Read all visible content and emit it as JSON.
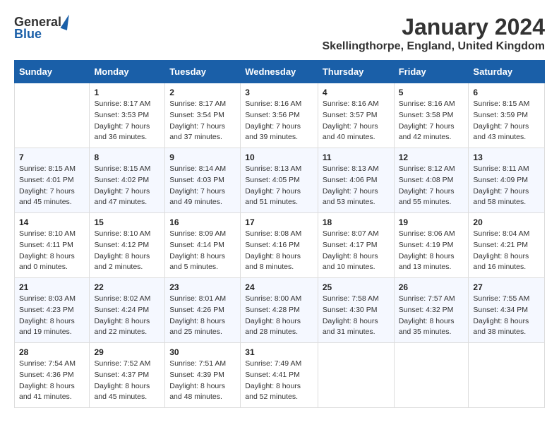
{
  "header": {
    "logo_general": "General",
    "logo_blue": "Blue",
    "month_title": "January 2024",
    "location": "Skellingthorpe, England, United Kingdom"
  },
  "days_of_week": [
    "Sunday",
    "Monday",
    "Tuesday",
    "Wednesday",
    "Thursday",
    "Friday",
    "Saturday"
  ],
  "weeks": [
    [
      {
        "day": "",
        "sunrise": "",
        "sunset": "",
        "daylight": ""
      },
      {
        "day": "1",
        "sunrise": "Sunrise: 8:17 AM",
        "sunset": "Sunset: 3:53 PM",
        "daylight": "Daylight: 7 hours and 36 minutes."
      },
      {
        "day": "2",
        "sunrise": "Sunrise: 8:17 AM",
        "sunset": "Sunset: 3:54 PM",
        "daylight": "Daylight: 7 hours and 37 minutes."
      },
      {
        "day": "3",
        "sunrise": "Sunrise: 8:16 AM",
        "sunset": "Sunset: 3:56 PM",
        "daylight": "Daylight: 7 hours and 39 minutes."
      },
      {
        "day": "4",
        "sunrise": "Sunrise: 8:16 AM",
        "sunset": "Sunset: 3:57 PM",
        "daylight": "Daylight: 7 hours and 40 minutes."
      },
      {
        "day": "5",
        "sunrise": "Sunrise: 8:16 AM",
        "sunset": "Sunset: 3:58 PM",
        "daylight": "Daylight: 7 hours and 42 minutes."
      },
      {
        "day": "6",
        "sunrise": "Sunrise: 8:15 AM",
        "sunset": "Sunset: 3:59 PM",
        "daylight": "Daylight: 7 hours and 43 minutes."
      }
    ],
    [
      {
        "day": "7",
        "sunrise": "Sunrise: 8:15 AM",
        "sunset": "Sunset: 4:01 PM",
        "daylight": "Daylight: 7 hours and 45 minutes."
      },
      {
        "day": "8",
        "sunrise": "Sunrise: 8:15 AM",
        "sunset": "Sunset: 4:02 PM",
        "daylight": "Daylight: 7 hours and 47 minutes."
      },
      {
        "day": "9",
        "sunrise": "Sunrise: 8:14 AM",
        "sunset": "Sunset: 4:03 PM",
        "daylight": "Daylight: 7 hours and 49 minutes."
      },
      {
        "day": "10",
        "sunrise": "Sunrise: 8:13 AM",
        "sunset": "Sunset: 4:05 PM",
        "daylight": "Daylight: 7 hours and 51 minutes."
      },
      {
        "day": "11",
        "sunrise": "Sunrise: 8:13 AM",
        "sunset": "Sunset: 4:06 PM",
        "daylight": "Daylight: 7 hours and 53 minutes."
      },
      {
        "day": "12",
        "sunrise": "Sunrise: 8:12 AM",
        "sunset": "Sunset: 4:08 PM",
        "daylight": "Daylight: 7 hours and 55 minutes."
      },
      {
        "day": "13",
        "sunrise": "Sunrise: 8:11 AM",
        "sunset": "Sunset: 4:09 PM",
        "daylight": "Daylight: 7 hours and 58 minutes."
      }
    ],
    [
      {
        "day": "14",
        "sunrise": "Sunrise: 8:10 AM",
        "sunset": "Sunset: 4:11 PM",
        "daylight": "Daylight: 8 hours and 0 minutes."
      },
      {
        "day": "15",
        "sunrise": "Sunrise: 8:10 AM",
        "sunset": "Sunset: 4:12 PM",
        "daylight": "Daylight: 8 hours and 2 minutes."
      },
      {
        "day": "16",
        "sunrise": "Sunrise: 8:09 AM",
        "sunset": "Sunset: 4:14 PM",
        "daylight": "Daylight: 8 hours and 5 minutes."
      },
      {
        "day": "17",
        "sunrise": "Sunrise: 8:08 AM",
        "sunset": "Sunset: 4:16 PM",
        "daylight": "Daylight: 8 hours and 8 minutes."
      },
      {
        "day": "18",
        "sunrise": "Sunrise: 8:07 AM",
        "sunset": "Sunset: 4:17 PM",
        "daylight": "Daylight: 8 hours and 10 minutes."
      },
      {
        "day": "19",
        "sunrise": "Sunrise: 8:06 AM",
        "sunset": "Sunset: 4:19 PM",
        "daylight": "Daylight: 8 hours and 13 minutes."
      },
      {
        "day": "20",
        "sunrise": "Sunrise: 8:04 AM",
        "sunset": "Sunset: 4:21 PM",
        "daylight": "Daylight: 8 hours and 16 minutes."
      }
    ],
    [
      {
        "day": "21",
        "sunrise": "Sunrise: 8:03 AM",
        "sunset": "Sunset: 4:23 PM",
        "daylight": "Daylight: 8 hours and 19 minutes."
      },
      {
        "day": "22",
        "sunrise": "Sunrise: 8:02 AM",
        "sunset": "Sunset: 4:24 PM",
        "daylight": "Daylight: 8 hours and 22 minutes."
      },
      {
        "day": "23",
        "sunrise": "Sunrise: 8:01 AM",
        "sunset": "Sunset: 4:26 PM",
        "daylight": "Daylight: 8 hours and 25 minutes."
      },
      {
        "day": "24",
        "sunrise": "Sunrise: 8:00 AM",
        "sunset": "Sunset: 4:28 PM",
        "daylight": "Daylight: 8 hours and 28 minutes."
      },
      {
        "day": "25",
        "sunrise": "Sunrise: 7:58 AM",
        "sunset": "Sunset: 4:30 PM",
        "daylight": "Daylight: 8 hours and 31 minutes."
      },
      {
        "day": "26",
        "sunrise": "Sunrise: 7:57 AM",
        "sunset": "Sunset: 4:32 PM",
        "daylight": "Daylight: 8 hours and 35 minutes."
      },
      {
        "day": "27",
        "sunrise": "Sunrise: 7:55 AM",
        "sunset": "Sunset: 4:34 PM",
        "daylight": "Daylight: 8 hours and 38 minutes."
      }
    ],
    [
      {
        "day": "28",
        "sunrise": "Sunrise: 7:54 AM",
        "sunset": "Sunset: 4:36 PM",
        "daylight": "Daylight: 8 hours and 41 minutes."
      },
      {
        "day": "29",
        "sunrise": "Sunrise: 7:52 AM",
        "sunset": "Sunset: 4:37 PM",
        "daylight": "Daylight: 8 hours and 45 minutes."
      },
      {
        "day": "30",
        "sunrise": "Sunrise: 7:51 AM",
        "sunset": "Sunset: 4:39 PM",
        "daylight": "Daylight: 8 hours and 48 minutes."
      },
      {
        "day": "31",
        "sunrise": "Sunrise: 7:49 AM",
        "sunset": "Sunset: 4:41 PM",
        "daylight": "Daylight: 8 hours and 52 minutes."
      },
      {
        "day": "",
        "sunrise": "",
        "sunset": "",
        "daylight": ""
      },
      {
        "day": "",
        "sunrise": "",
        "sunset": "",
        "daylight": ""
      },
      {
        "day": "",
        "sunrise": "",
        "sunset": "",
        "daylight": ""
      }
    ]
  ]
}
